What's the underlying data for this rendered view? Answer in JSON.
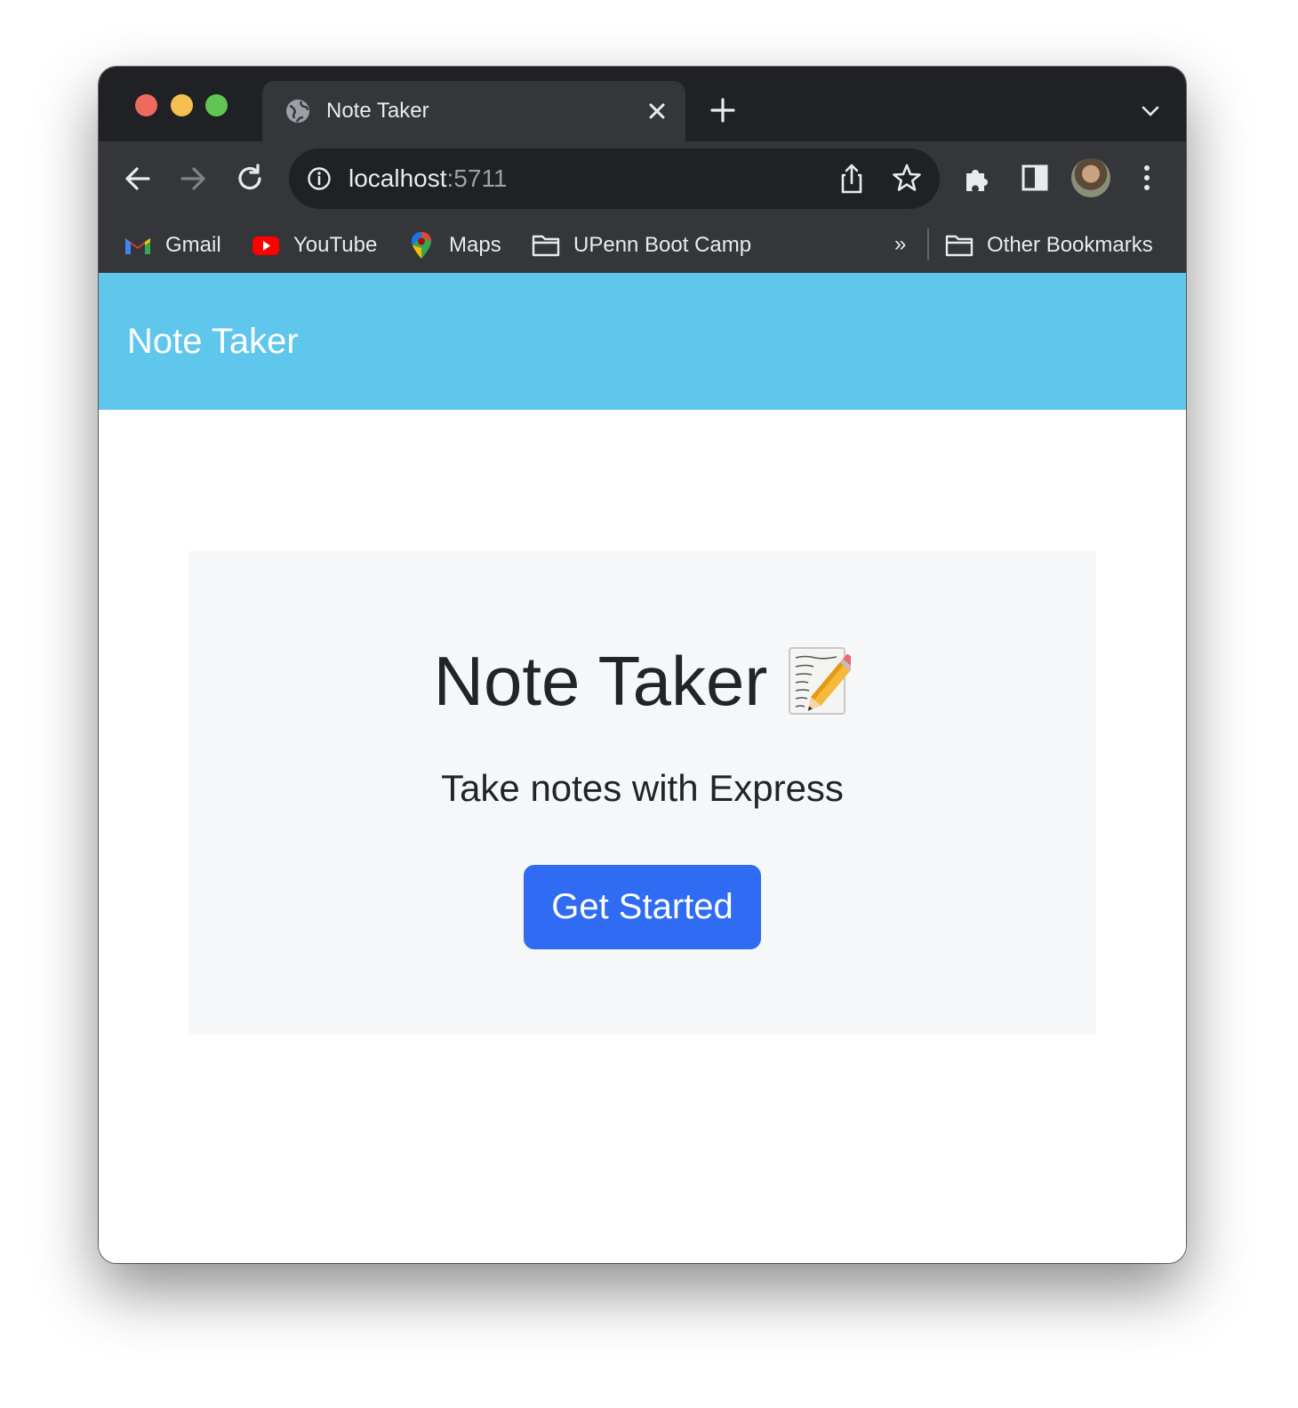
{
  "browser": {
    "tab": {
      "title": "Note Taker",
      "favicon": "globe-icon"
    },
    "address": {
      "host": "localhost",
      "port": ":5711"
    },
    "bookmarks": [
      {
        "label": "Gmail",
        "icon": "gmail-icon"
      },
      {
        "label": "YouTube",
        "icon": "youtube-icon"
      },
      {
        "label": "Maps",
        "icon": "maps-icon"
      },
      {
        "label": "UPenn Boot Camp",
        "icon": "folder-icon"
      }
    ],
    "overflow_label": "»",
    "other_bookmarks": {
      "label": "Other Bookmarks",
      "icon": "folder-icon"
    }
  },
  "page": {
    "navbar": {
      "brand": "Note Taker",
      "color": "#5fc7ec"
    },
    "hero": {
      "title": "Note Taker",
      "emoji": "memo-icon",
      "subtitle": "Take notes with Express",
      "button_label": "Get Started",
      "button_color": "#2f6cf3"
    }
  }
}
